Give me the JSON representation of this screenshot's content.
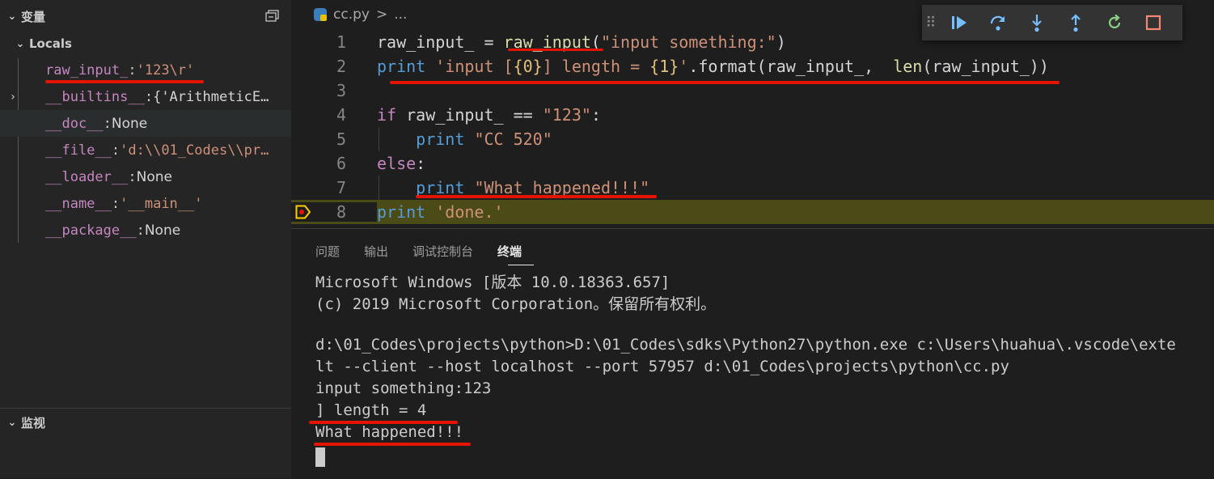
{
  "sidebar": {
    "variables_title": "变量",
    "locals_label": "Locals",
    "vars": [
      {
        "name": "raw_input_",
        "value": "'123\\r'"
      },
      {
        "name": "__builtins__",
        "value": "{'ArithmeticE…"
      },
      {
        "name": "__doc__",
        "value": "None"
      },
      {
        "name": "__file__",
        "value": "'d:\\\\01_Codes\\\\pr…"
      },
      {
        "name": "__loader__",
        "value": "None"
      },
      {
        "name": "__name__",
        "value": "'__main__'"
      },
      {
        "name": "__package__",
        "value": "None"
      }
    ],
    "watch_title": "监视"
  },
  "editor": {
    "breadcrumb_file": "cc.py",
    "breadcrumb_sep": ">",
    "breadcrumb_more": "...",
    "line_numbers": [
      "1",
      "2",
      "3",
      "4",
      "5",
      "6",
      "7",
      "8"
    ],
    "lines": {
      "l1": {
        "a": "raw_input_",
        "b": " = ",
        "c": "raw_input",
        "d": "(",
        "e": "\"input something:\"",
        "f": ")"
      },
      "l2": {
        "a": "print",
        "b": " 'input [",
        "c": "{0}",
        "d": "] length = ",
        "e": "{1}",
        "f": "'",
        "g": ".format(raw_input_,  ",
        "h": "len",
        "i": "(raw_input_))"
      },
      "l4": {
        "a": "if",
        "b": " raw_input_ == ",
        "c": "\"123\"",
        "d": ":"
      },
      "l5": {
        "a": "    ",
        "b": "print",
        "c": " ",
        "d": "\"CC 520\""
      },
      "l6": {
        "a": "else",
        "b": ":"
      },
      "l7": {
        "a": "    ",
        "b": "print",
        "c": " ",
        "d": "\"What happened!!!\""
      },
      "l8": {
        "a": "print",
        "b": " ",
        "c": "'done.'"
      }
    }
  },
  "debug_toolbar": {
    "buttons": [
      "continue",
      "step-over",
      "step-into",
      "step-out",
      "restart",
      "stop"
    ]
  },
  "panel": {
    "tabs": [
      "问题",
      "输出",
      "调试控制台",
      "终端"
    ],
    "active_tab": "终端",
    "terminal_lines": [
      "Microsoft Windows [版本 10.0.18363.657]",
      "(c) 2019 Microsoft Corporation。保留所有权利。",
      "",
      "d:\\01_Codes\\projects\\python>D:\\01_Codes\\sdks\\Python27\\python.exe c:\\Users\\huahua\\.vscode\\exte",
      "lt --client --host localhost --port 57957 d:\\01_Codes\\projects\\python\\cc.py",
      "input something:123",
      "] length = 4",
      "What happened!!!"
    ]
  },
  "colors": {
    "annotation_red": "#e51400",
    "current_line_bg": "#4b4b18",
    "breakpoint_arrow": "#ffcc00"
  }
}
